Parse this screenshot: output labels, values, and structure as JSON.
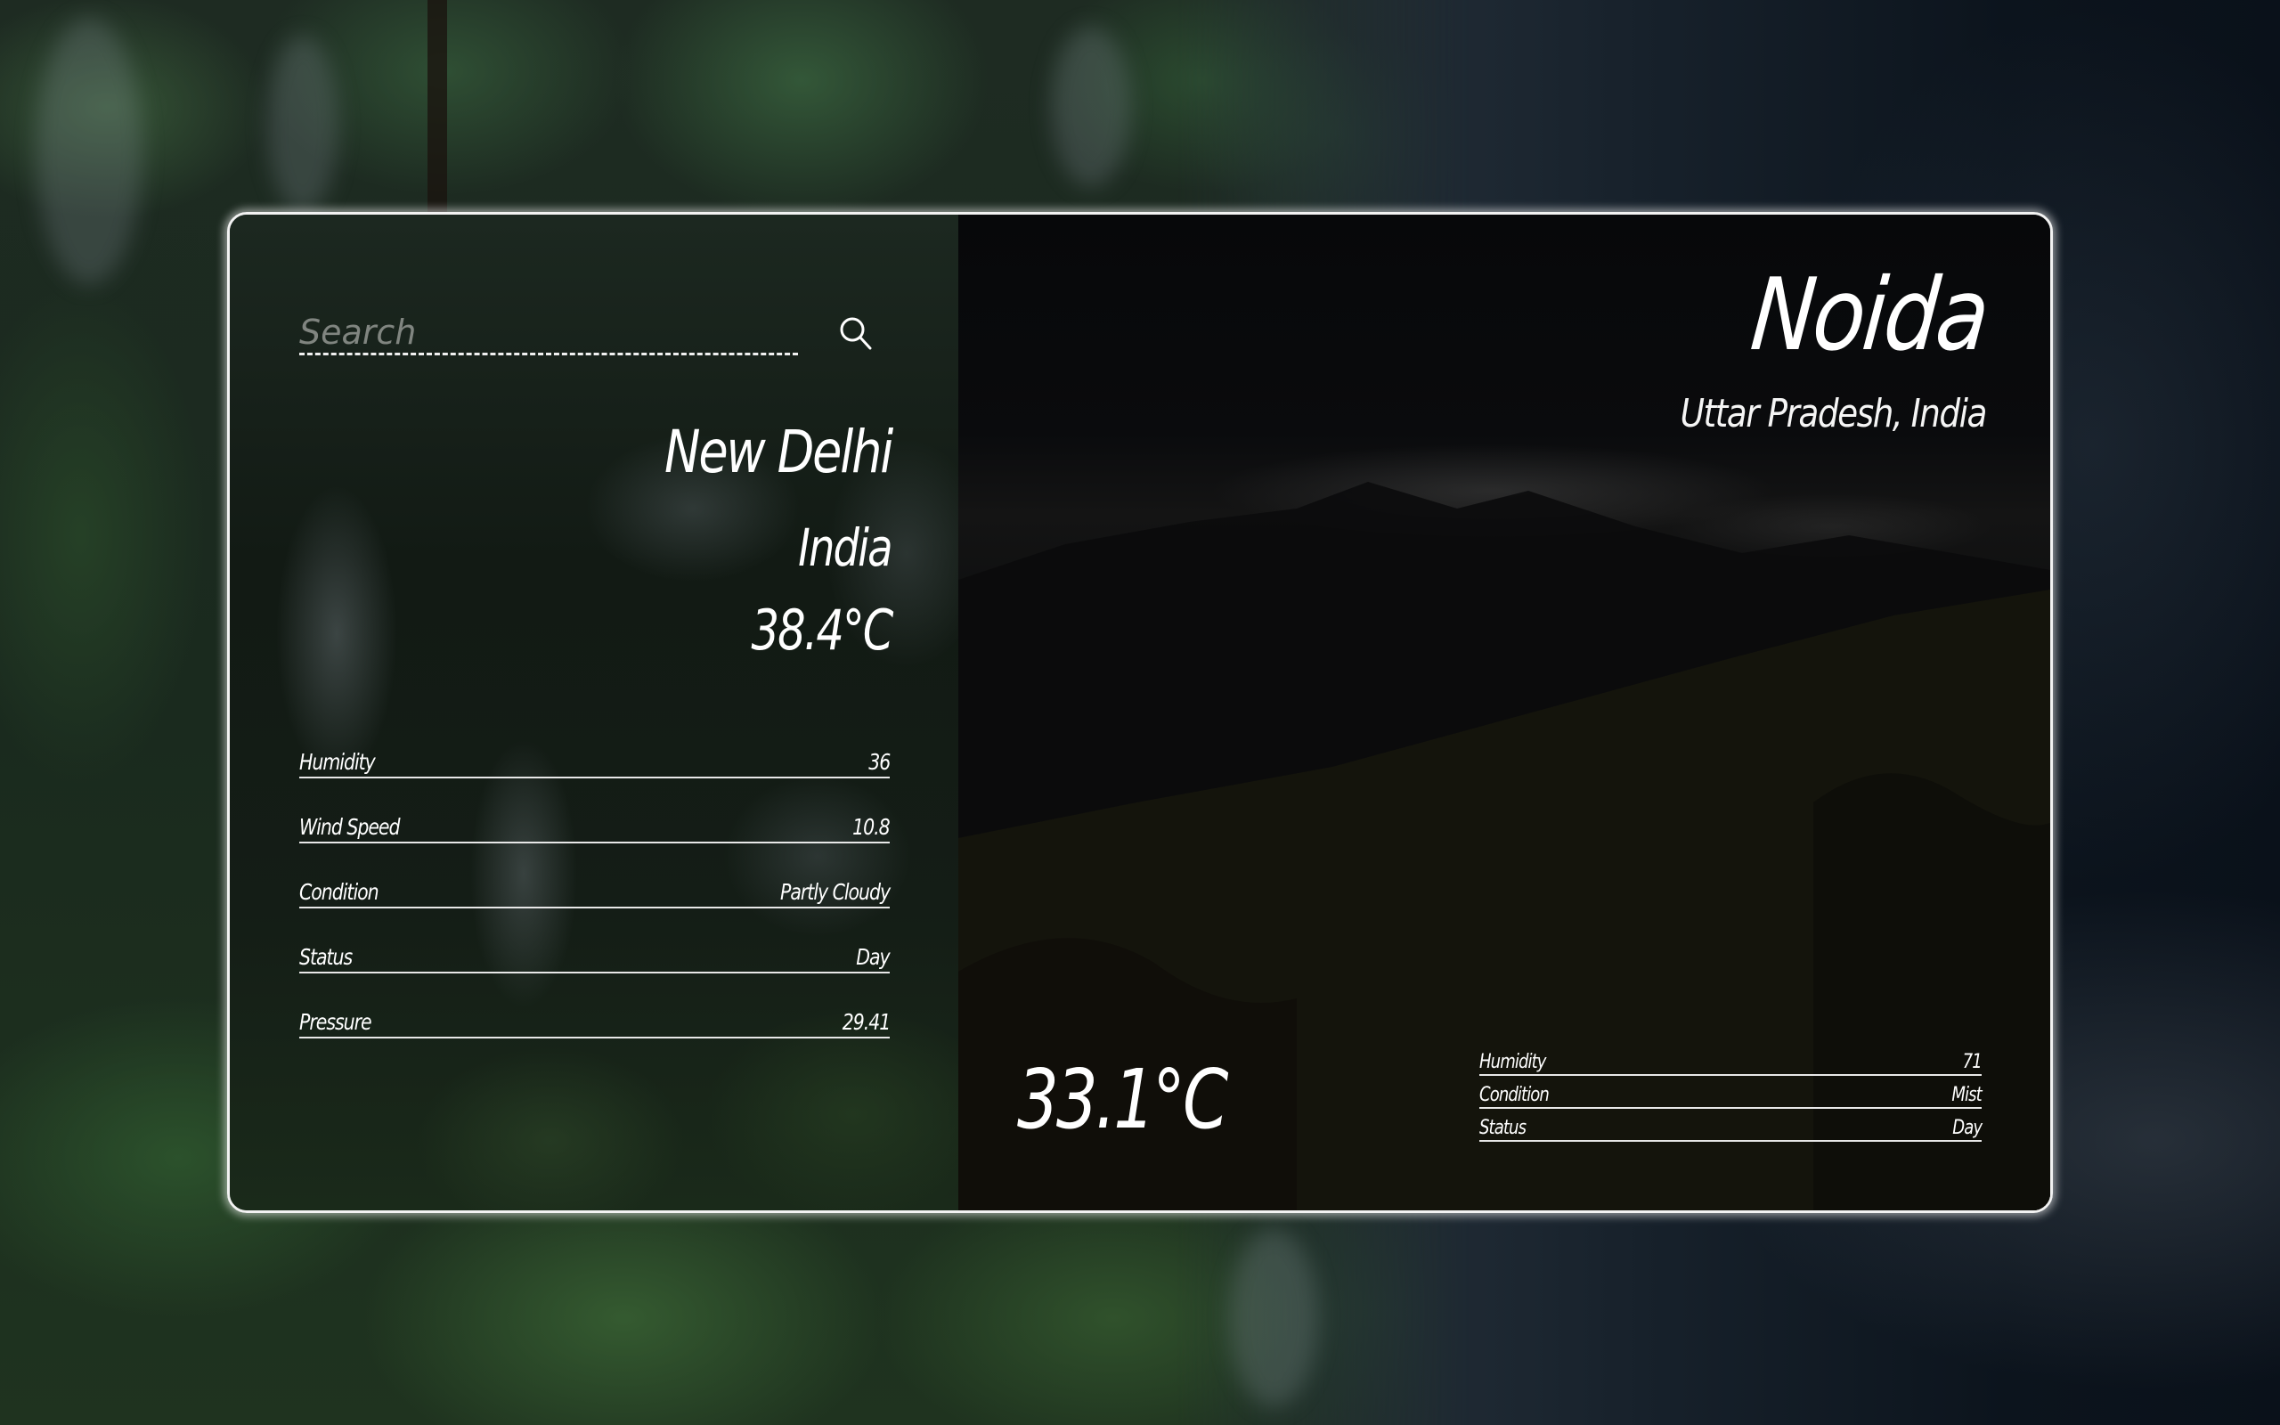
{
  "search": {
    "placeholder": "Search",
    "value": "",
    "icon": "search-icon"
  },
  "current": {
    "city": "New Delhi",
    "country": "India",
    "temperature": "38.4°C",
    "stats": [
      {
        "label": "Humidity",
        "value": "36"
      },
      {
        "label": "Wind Speed",
        "value": "10.8"
      },
      {
        "label": "Condition",
        "value": "Partly Cloudy"
      },
      {
        "label": "Status",
        "value": "Day"
      },
      {
        "label": "Pressure",
        "value": "29.41"
      }
    ]
  },
  "featured": {
    "city": "Noida",
    "region": "Uttar Pradesh, India",
    "temperature": "33.1°C",
    "stats": [
      {
        "label": "Humidity",
        "value": "71"
      },
      {
        "label": "Condition",
        "value": "Mist"
      },
      {
        "label": "Status",
        "value": "Day"
      }
    ]
  },
  "colors": {
    "text": "#ffffff",
    "card_border": "#f2f2f2",
    "placeholder": "#808580"
  }
}
